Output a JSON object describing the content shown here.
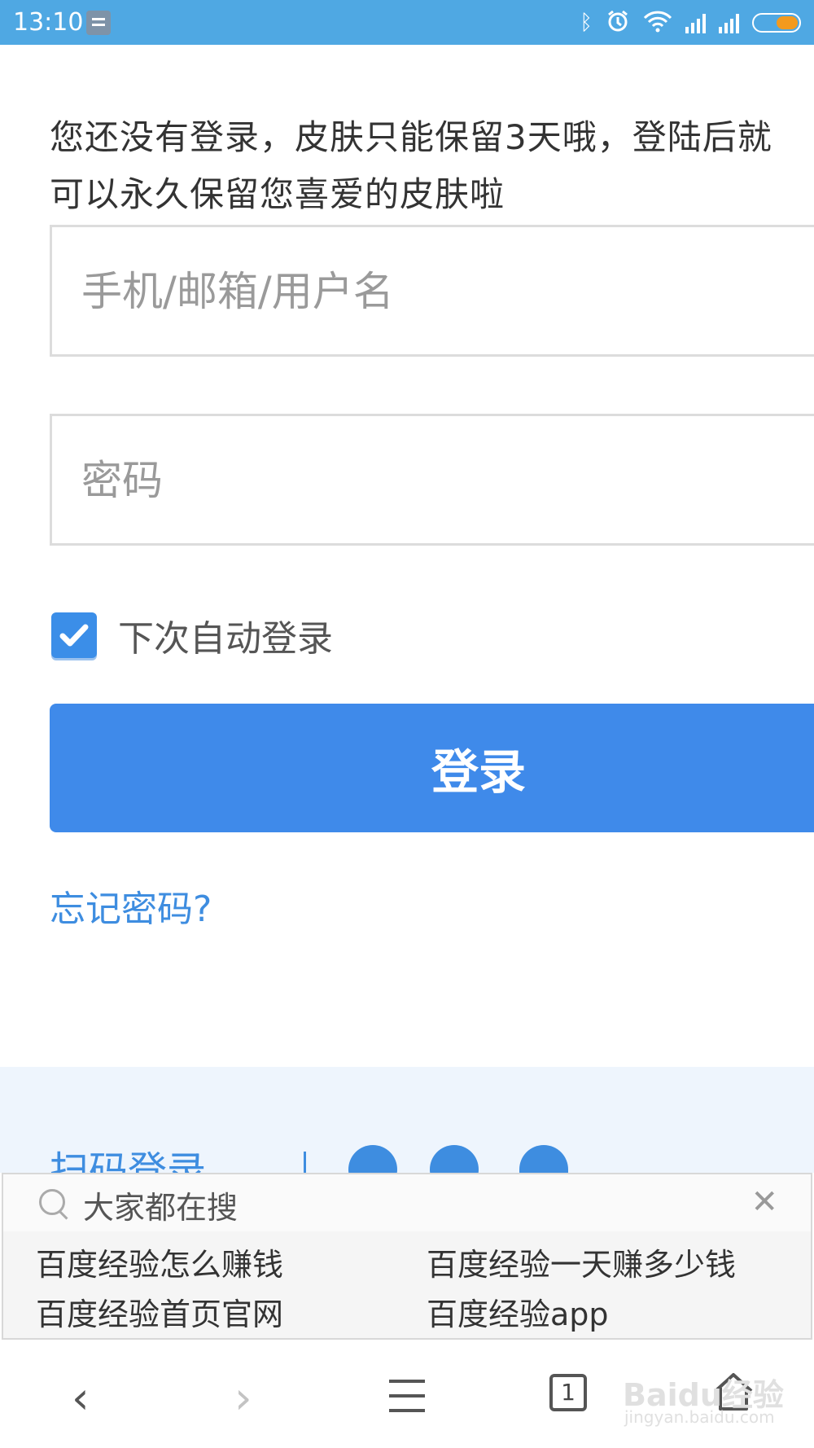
{
  "status_bar": {
    "time": "13:10",
    "icons": [
      "bluetooth-icon",
      "alarm-icon",
      "wifi-icon",
      "signal-icon",
      "signal-icon",
      "battery-icon"
    ]
  },
  "login": {
    "notice": "您还没有登录，皮肤只能保留3天哦，登陆后就可以永久保留您喜爱的皮肤啦",
    "username_placeholder": "手机/邮箱/用户名",
    "username_value": "",
    "password_placeholder": "密码",
    "password_value": "",
    "remember_label": "下次自动登录",
    "remember_checked": true,
    "login_button": "登录",
    "forgot_password": "忘记密码?",
    "qr_login": "扫码登录",
    "social_icons": [
      "weibo-icon",
      "wechat-icon",
      "qq-icon"
    ]
  },
  "suggest": {
    "title": "大家都在搜",
    "items": [
      "百度经验怎么赚钱",
      "百度经验一天赚多少钱",
      "百度经验首页官网",
      "百度经验app"
    ]
  },
  "nav": {
    "tab_count": "1",
    "buttons": [
      "back-icon",
      "forward-icon",
      "menu-icon",
      "tabs-icon",
      "home-icon"
    ]
  },
  "watermark": {
    "logo": "Baidu经验",
    "url": "jingyan.baidu.com"
  },
  "colors": {
    "status_bar": "#4fa8e3",
    "primary": "#3f8aea",
    "link": "#3e8de0",
    "battery": "#f39a1e"
  }
}
